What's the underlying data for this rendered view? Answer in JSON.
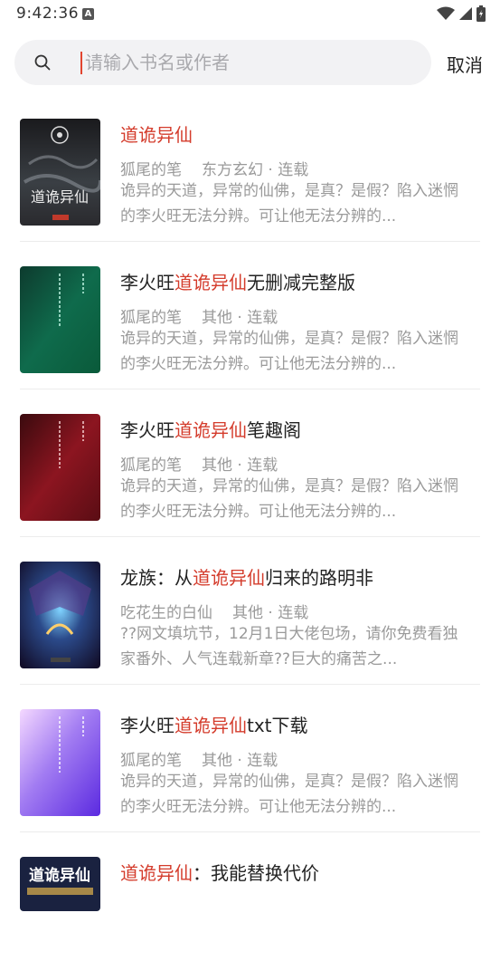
{
  "status_bar": {
    "time": "9:42:36",
    "notification_icon": "A",
    "icons": [
      "wifi-icon",
      "signal-icon",
      "battery-icon"
    ]
  },
  "search": {
    "placeholder": "请输入书名或作者",
    "value": "",
    "cancel_label": "取消"
  },
  "colors": {
    "highlight": "#d43c2c",
    "meta": "#9a9a9a",
    "search_bg": "#f2f2f4"
  },
  "results": [
    {
      "title_pre": "",
      "title_hl": "道诡异仙",
      "title_post": "",
      "author": "狐尾的笔",
      "meta": "东方玄幻 · 连载",
      "desc": "诡异的天道，异常的仙佛，是真？是假？陷入迷惘的李火旺无法分辨。可让他无法分辨的...",
      "cover_text": "道诡异仙"
    },
    {
      "title_pre": "李火旺",
      "title_hl": "道诡异仙",
      "title_post": "无删减完整版",
      "author": "狐尾的笔",
      "meta": "其他 · 连载",
      "desc": "诡异的天道，异常的仙佛，是真？是假？陷入迷惘的李火旺无法分辨。可让他无法分辨的...",
      "cover_text": ""
    },
    {
      "title_pre": "李火旺",
      "title_hl": "道诡异仙",
      "title_post": "笔趣阁",
      "author": "狐尾的笔",
      "meta": "其他 · 连载",
      "desc": "诡异的天道，异常的仙佛，是真？是假？陷入迷惘的李火旺无法分辨。可让他无法分辨的...",
      "cover_text": ""
    },
    {
      "title_pre": "龙族：从",
      "title_hl": "道诡异仙",
      "title_post": "归来的路明非",
      "author": "吃花生的白仙",
      "meta": "其他 · 连载",
      "desc": "??网文填坑节，12月1日大佬包场，请你免费看独家番外、人气连载新章??巨大的痛苦之...",
      "cover_text": ""
    },
    {
      "title_pre": "李火旺",
      "title_hl": "道诡异仙",
      "title_post": "txt下载",
      "author": "狐尾的笔",
      "meta": "其他 · 连载",
      "desc": "诡异的天道，异常的仙佛，是真？是假？陷入迷惘的李火旺无法分辨。可让他无法分辨的...",
      "cover_text": ""
    },
    {
      "title_pre": "",
      "title_hl": "道诡异仙",
      "title_post": "：我能替换代价",
      "author": "",
      "meta": "",
      "desc": "",
      "cover_text": "道诡异仙"
    }
  ]
}
